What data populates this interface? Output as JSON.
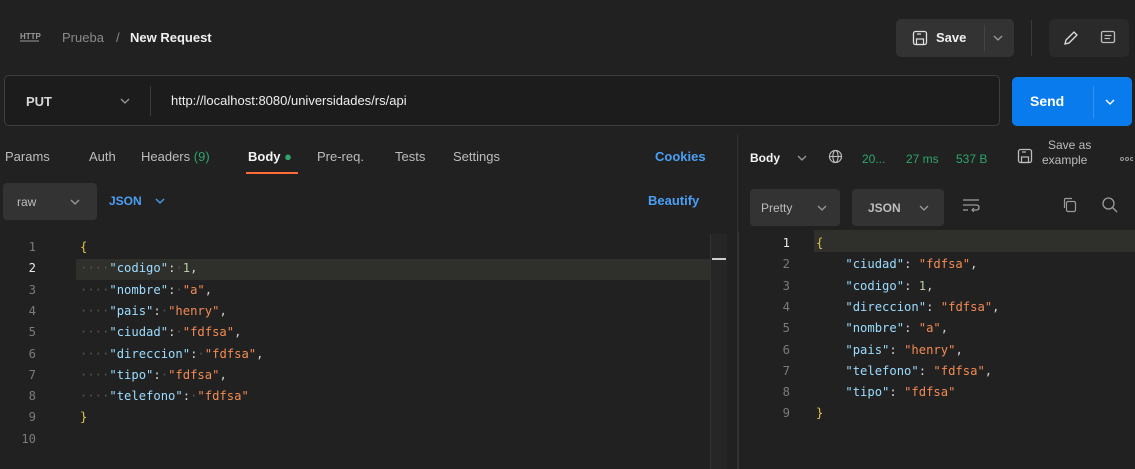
{
  "header": {
    "http_badge": "HTTP",
    "breadcrumb_parent": "Prueba",
    "breadcrumb_sep": "/",
    "breadcrumb_current": "New Request",
    "save_label": "Save"
  },
  "request": {
    "method": "PUT",
    "url": "http://localhost:8080/universidades/rs/api",
    "send_label": "Send"
  },
  "request_tabs": {
    "params": "Params",
    "auth": "Auth",
    "headers": "Headers",
    "headers_count": "(9)",
    "body": "Body",
    "prereq": "Pre-req.",
    "tests": "Tests",
    "settings": "Settings",
    "cookies": "Cookies"
  },
  "body_options": {
    "mode": "raw",
    "format": "JSON",
    "beautify": "Beautify"
  },
  "request_body": {
    "line_numbers": [
      "1",
      "2",
      "3",
      "4",
      "5",
      "6",
      "7",
      "8",
      "9",
      "10"
    ],
    "fields": [
      {
        "key": "\"codigo\"",
        "value": "1",
        "type": "number",
        "comma": ","
      },
      {
        "key": "\"nombre\"",
        "value": "\"a\"",
        "type": "string",
        "comma": ","
      },
      {
        "key": "\"pais\"",
        "value": "\"henry\"",
        "type": "string",
        "comma": ","
      },
      {
        "key": "\"ciudad\"",
        "value": "\"fdfsa\"",
        "type": "string",
        "comma": ","
      },
      {
        "key": "\"direccion\"",
        "value": "\"fdfsa\"",
        "type": "string",
        "comma": ","
      },
      {
        "key": "\"tipo\"",
        "value": "\"fdfsa\"",
        "type": "string",
        "comma": ","
      },
      {
        "key": "\"telefono\"",
        "value": "\"fdfsa\"",
        "type": "string",
        "comma": ""
      }
    ],
    "open_brace": "{",
    "close_brace": "}"
  },
  "response": {
    "label": "Body",
    "status": "20...",
    "time": "27 ms",
    "size": "537 B",
    "save_as_example_line1": "Save as",
    "save_as_example_line2": "example",
    "view_mode": "Pretty",
    "format": "JSON",
    "line_numbers": [
      "1",
      "2",
      "3",
      "4",
      "5",
      "6",
      "7",
      "8",
      "9"
    ],
    "fields": [
      {
        "key": "\"ciudad\"",
        "value": "\"fdfsa\"",
        "type": "string",
        "comma": ","
      },
      {
        "key": "\"codigo\"",
        "value": "1",
        "type": "number",
        "comma": ","
      },
      {
        "key": "\"direccion\"",
        "value": "\"fdfsa\"",
        "type": "string",
        "comma": ","
      },
      {
        "key": "\"nombre\"",
        "value": "\"a\"",
        "type": "string",
        "comma": ","
      },
      {
        "key": "\"pais\"",
        "value": "\"henry\"",
        "type": "string",
        "comma": ","
      },
      {
        "key": "\"telefono\"",
        "value": "\"fdfsa\"",
        "type": "string",
        "comma": ","
      },
      {
        "key": "\"tipo\"",
        "value": "\"fdfsa\"",
        "type": "string",
        "comma": ""
      }
    ],
    "open_brace": "{",
    "close_brace": "}"
  },
  "colors": {
    "background": "#212121",
    "send_button": "#097bed",
    "accent_orange": "#ff6c37",
    "status_green": "#2ea56b",
    "link_blue": "#4a9ff5"
  },
  "icons": [
    "http-icon",
    "save-icon",
    "chevron-down-icon",
    "pencil-icon",
    "comment-icon",
    "globe-icon",
    "wrap-icon",
    "copy-icon",
    "search-icon",
    "more-icon"
  ]
}
